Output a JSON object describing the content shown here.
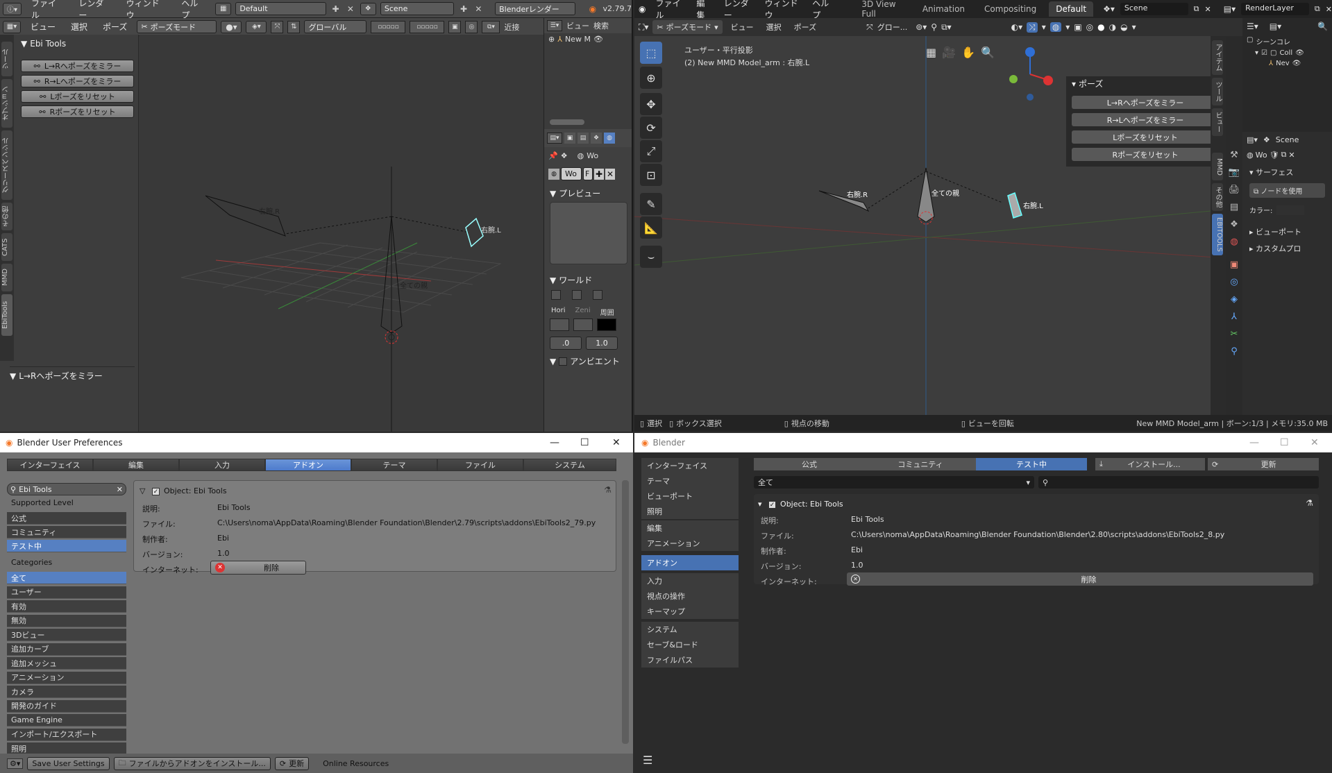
{
  "b279": {
    "menus": [
      "ファイル",
      "レンダー",
      "ウィンドウ",
      "ヘルプ"
    ],
    "layout": "Default",
    "scene": "Scene",
    "engine": "Blenderレンダー",
    "version": "v2.79.7",
    "vp_menus": [
      "ビュー",
      "選択",
      "ポーズ"
    ],
    "mode": "ポーズモード",
    "orientation": "グローバル",
    "snap": "近接",
    "panel_title": "Ebi Tools",
    "ops": [
      "L→Rへポーズをミラー",
      "R→Lへポーズをミラー",
      "Lポーズをリセット",
      "Rポーズをリセット"
    ],
    "last_op": "L→Rへポーズをミラー",
    "tabs": [
      "ツール",
      "オプション",
      "グリースペンシル",
      "その他",
      "CATS",
      "MMD",
      "EbiTools"
    ],
    "bone_r": "右腕.R",
    "bone_l": "右腕.L",
    "bone_root": "全ての親",
    "outliner_menus": [
      "ビュー",
      "検索"
    ],
    "outliner_item": "New M",
    "props_world_field": "Wo",
    "props_world_hdr": "Wo",
    "props_world_f": "F",
    "preview": "プレビュー",
    "world": "ワールド",
    "world_labels": [
      "Hori",
      "Zeni",
      "周囲"
    ],
    "world_vals": [
      ".0",
      "1.0"
    ],
    "ambient": "アンビエント"
  },
  "b280": {
    "menus": [
      "ファイル",
      "編集",
      "レンダー",
      "ウィンドウ",
      "ヘルプ"
    ],
    "workspaces": [
      "3D View Full",
      "Animation",
      "Compositing",
      "Default"
    ],
    "active_ws": "Default",
    "scene": "Scene",
    "view_layer": "RenderLayer",
    "mode": "ポーズモード",
    "vp_menus": [
      "ビュー",
      "選択",
      "ポーズ"
    ],
    "orientation": "グロー...",
    "view_name": "ユーザー・平行投影",
    "object_info": "(2) New MMD Model_arm : 右腕.L",
    "pose_panel": "ポーズ",
    "ops": [
      "L→Rへポーズをミラー",
      "R→Lへポーズをミラー",
      "Lポーズをリセット",
      "Rポーズをリセット"
    ],
    "ntabs": [
      "アイテム",
      "ツール",
      "ビュー",
      "MMD",
      "その他",
      "EBITOOLS"
    ],
    "bone_r": "右腕.R",
    "bone_l": "右腕.L",
    "bone_root": "全ての親",
    "outliner": {
      "collection": "シーンコレ",
      "coll": "Coll",
      "item": "Nev"
    },
    "props": {
      "scene": "Scene",
      "world": "Wo",
      "surface": "サーフェス",
      "use_nodes": "ノードを使用",
      "color": "カラー:",
      "viewport": "ビューポート",
      "custom": "カスタムプロ"
    },
    "status": [
      "選択",
      "ボックス選択",
      "視点の移動",
      "ビューを回転"
    ],
    "status_right": "New MMD Model_arm | ボーン:1/3 | メモリ:35.0 MB"
  },
  "pref279": {
    "title": "Blender User Preferences",
    "tabs": [
      "インターフェイス",
      "編集",
      "入力",
      "アドオン",
      "テーマ",
      "ファイル",
      "システム"
    ],
    "active_tab": "アドオン",
    "search": "Ebi Tools",
    "supported_level": "Supported Level",
    "levels": [
      "公式",
      "コミュニティ",
      "テスト中"
    ],
    "categories_label": "Categories",
    "categories": [
      "全て",
      "ユーザー",
      "有効",
      "無効",
      "3Dビュー",
      "追加カーブ",
      "追加メッシュ",
      "アニメーション",
      "カメラ",
      "開発のガイド",
      "Game Engine",
      "インポート/エクスポート",
      "照明"
    ],
    "addon": {
      "name": "Object: Ebi Tools",
      "desc_k": "説明:",
      "desc": "Ebi Tools",
      "file_k": "ファイル:",
      "file": "C:\\Users\\noma\\AppData\\Roaming\\Blender Foundation\\Blender\\2.79\\scripts\\addons\\EbiTools2_79.py",
      "author_k": "制作者:",
      "author": "Ebi",
      "version_k": "バージョン:",
      "version": "1.0",
      "internet_k": "インターネット:",
      "remove": "削除"
    },
    "footer": {
      "save": "Save User Settings",
      "install": "ファイルからアドオンをインストール...",
      "refresh": "更新",
      "online": "Online Resources"
    }
  },
  "pref280": {
    "title": "Blender",
    "side": [
      "インターフェイス",
      "テーマ",
      "ビューポート",
      "照明",
      "編集",
      "アニメーション",
      "アドオン",
      "入力",
      "視点の操作",
      "キーマップ",
      "システム",
      "セーブ&ロード",
      "ファイルパス"
    ],
    "active_side": "アドオン",
    "tabs": [
      "公式",
      "コミュニティ",
      "テスト中"
    ],
    "active_tab": "テスト中",
    "install": "インストール...",
    "refresh": "更新",
    "filter": "全て",
    "addon": {
      "name": "Object: Ebi Tools",
      "desc_k": "説明:",
      "desc": "Ebi Tools",
      "file_k": "ファイル:",
      "file": "C:\\Users\\noma\\AppData\\Roaming\\Blender Foundation\\Blender\\2.80\\scripts\\addons\\EbiTools2_8.py",
      "author_k": "制作者:",
      "author": "Ebi",
      "version_k": "バージョン:",
      "version": "1.0",
      "internet_k": "インターネット:",
      "remove": "削除"
    }
  }
}
